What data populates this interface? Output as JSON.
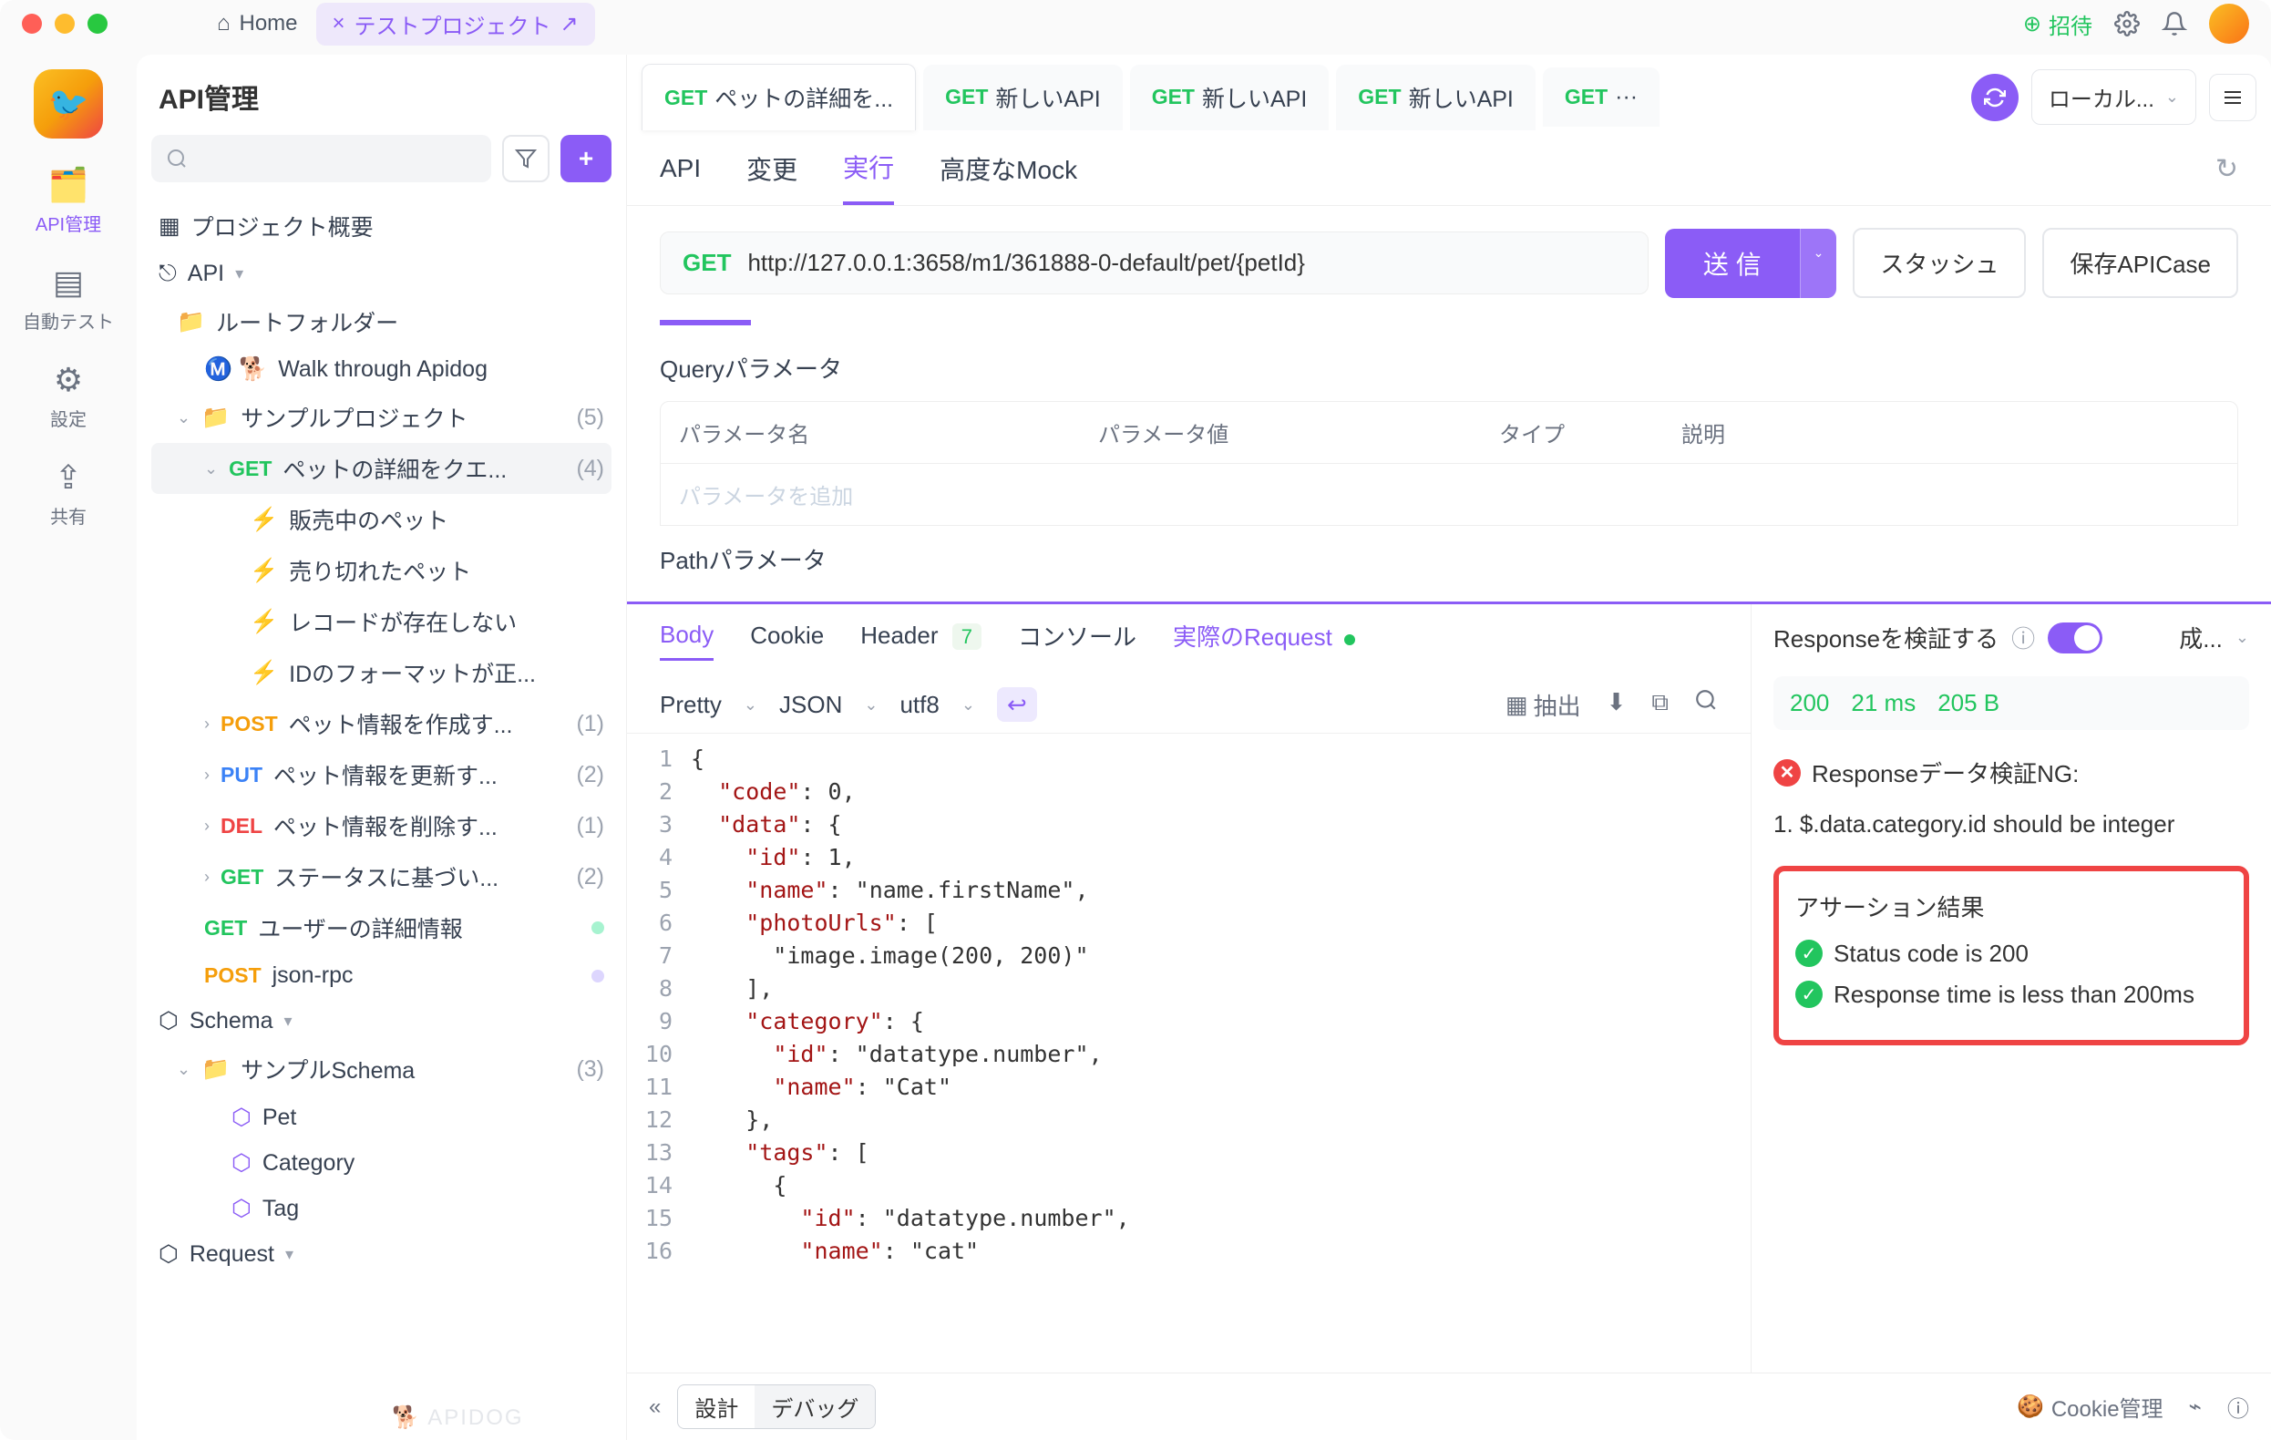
{
  "titlebar": {
    "home": "Home",
    "project_tab": "テストプロジェクト",
    "invite": "招待"
  },
  "rail": {
    "api": "API管理",
    "autotest": "自動テスト",
    "settings": "設定",
    "share": "共有"
  },
  "left": {
    "title": "API管理",
    "project_overview": "プロジェクト概要",
    "api_root": "API",
    "root_folder": "ルートフォルダー",
    "walkthrough": "Walk through Apidog",
    "sample_project": "サンプルプロジェクト",
    "sample_count": "(5)",
    "item_pet_detail": "ペットの詳細をクエ...",
    "item_pet_detail_count": "(4)",
    "case_on_sale": "販売中のペット",
    "case_sold_out": "売り切れたペット",
    "case_not_exist": "レコードが存在しない",
    "case_id_format": "IDのフォーマットが正...",
    "item_create": "ペット情報を作成す...",
    "item_create_count": "(1)",
    "item_update": "ペット情報を更新す...",
    "item_update_count": "(2)",
    "item_delete": "ペット情報を削除す...",
    "item_delete_count": "(1)",
    "item_status": "ステータスに基づい...",
    "item_status_count": "(2)",
    "item_user_detail": "ユーザーの詳細情報",
    "item_jsonrpc": "json-rpc",
    "schema_title": "Schema",
    "sample_schema": "サンプルSchema",
    "sample_schema_count": "(3)",
    "schema_pet": "Pet",
    "schema_category": "Category",
    "schema_tag": "Tag",
    "request_title": "Request",
    "watermark": "🐕 APIDOG",
    "methods": {
      "get": "GET",
      "post": "POST",
      "put": "PUT",
      "del": "DEL"
    }
  },
  "tabs": {
    "t1": "ペットの詳細を...",
    "t2": "新しいAPI",
    "t3": "新しいAPI",
    "t4": "新しいAPI",
    "env": "ローカル...",
    "method": "GET"
  },
  "subtabs": {
    "api": "API",
    "change": "変更",
    "run": "実行",
    "mock": "高度なMock"
  },
  "request": {
    "method": "GET",
    "url": "http://127.0.0.1:3658/m1/361888-0-default/pet/{petId}",
    "send": "送 信",
    "stash": "スタッシュ",
    "save_case": "保存APICase"
  },
  "params": {
    "query_title": "Queryパラメータ",
    "col_name": "パラメータ名",
    "col_value": "パラメータ値",
    "col_type": "タイプ",
    "col_desc": "説明",
    "add_placeholder": "パラメータを追加",
    "path_title": "Pathパラメータ"
  },
  "response": {
    "tab_body": "Body",
    "tab_cookie": "Cookie",
    "tab_header": "Header",
    "header_count": "7",
    "tab_console": "コンソール",
    "tab_actual": "実際のRequest",
    "fmt_pretty": "Pretty",
    "fmt_json": "JSON",
    "fmt_enc": "utf8",
    "extract": "抽出",
    "code_lines": [
      "{",
      "  \"code\": 0,",
      "  \"data\": {",
      "    \"id\": 1,",
      "    \"name\": \"name.firstName\",",
      "    \"photoUrls\": [",
      "      \"image.image(200, 200)\"",
      "    ],",
      "    \"category\": {",
      "      \"id\": \"datatype.number\",",
      "      \"name\": \"Cat\"",
      "    },",
      "    \"tags\": [",
      "      {",
      "        \"id\": \"datatype.number\",",
      "        \"name\": \"cat\""
    ]
  },
  "validate": {
    "title": "Responseを検証する",
    "success_dd": "成...",
    "status": "200",
    "time": "21 ms",
    "size": "205 B",
    "ng_title": "Responseデータ検証NG:",
    "ng_detail": "1. $.data.category.id should be integer",
    "assert_title": "アサーション結果",
    "assert1": "Status code is 200",
    "assert2": "Response time is less than 200ms"
  },
  "footer": {
    "design": "設計",
    "debug": "デバッグ",
    "cookie_mgmt": "Cookie管理"
  }
}
